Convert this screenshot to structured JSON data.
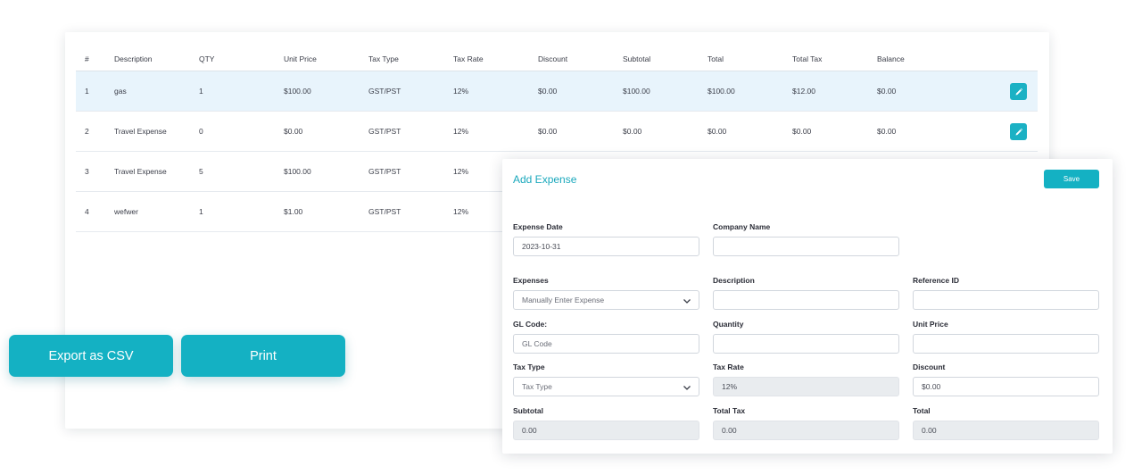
{
  "table": {
    "headers": [
      "#",
      "Description",
      "QTY",
      "Unit Price",
      "Tax Type",
      "Tax Rate",
      "Discount",
      "Subtotal",
      "Total",
      "Total Tax",
      "Balance"
    ],
    "rows": [
      [
        "1",
        "gas",
        "1",
        "$100.00",
        "GST/PST",
        "12%",
        "$0.00",
        "$100.00",
        "$100.00",
        "$12.00",
        "$0.00"
      ],
      [
        "2",
        "Travel Expense",
        "0",
        "$0.00",
        "GST/PST",
        "12%",
        "$0.00",
        "$0.00",
        "$0.00",
        "$0.00",
        "$0.00"
      ],
      [
        "3",
        "Travel Expense",
        "5",
        "$100.00",
        "GST/PST",
        "12%"
      ],
      [
        "4",
        "wefwer",
        "1",
        "$1.00",
        "GST/PST",
        "12%"
      ]
    ],
    "edit_icon": "pencil-icon",
    "selected_row": 1
  },
  "actions": {
    "export_csv": "Export as CSV",
    "print": "Print"
  },
  "add_expense": {
    "title": "Add Expense",
    "save": "Save",
    "fields": {
      "expense_date": {
        "label": "Expense Date",
        "value": "2023-10-31"
      },
      "company_name": {
        "label": "Company Name",
        "value": ""
      },
      "expenses": {
        "label": "Expenses",
        "value": "Manually Enter Expense"
      },
      "description": {
        "label": "Description",
        "value": ""
      },
      "reference_id": {
        "label": "Reference ID",
        "value": ""
      },
      "gl_code": {
        "label": "GL Code:",
        "placeholder": "GL Code"
      },
      "quantity": {
        "label": "Quantity",
        "value": ""
      },
      "unit_price": {
        "label": "Unit Price",
        "value": ""
      },
      "tax_type": {
        "label": "Tax Type",
        "value": "Tax Type"
      },
      "tax_rate": {
        "label": "Tax Rate",
        "value": "12%"
      },
      "discount": {
        "label": "Discount",
        "value": "$0.00"
      },
      "subtotal": {
        "label": "Subtotal",
        "value": "0.00"
      },
      "total_tax": {
        "label": "Total Tax",
        "value": "0.00"
      },
      "total": {
        "label": "Total",
        "value": "0.00"
      }
    }
  },
  "colors": {
    "accent": "#14b1c3",
    "accent_text": "#1aa8bc",
    "selected_row": "#e8f4fc",
    "readonly_bg": "#e9ecef"
  }
}
